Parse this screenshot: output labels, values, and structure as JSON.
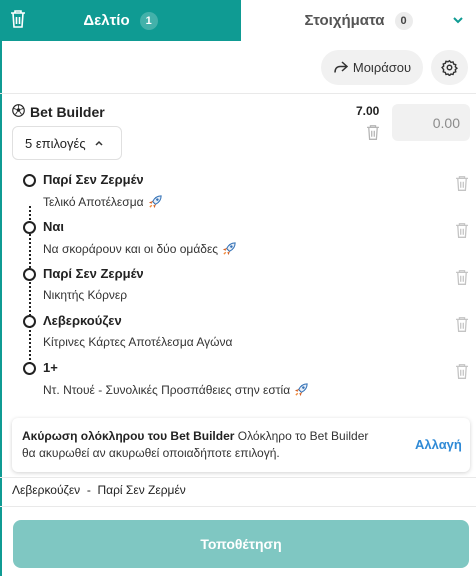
{
  "tabs": {
    "slip_label": "Δελτίο",
    "slip_count": "1",
    "bets_label": "Στοιχήματα",
    "bets_count": "0"
  },
  "toolbar": {
    "share_label": "Μοιράσου"
  },
  "bet_builder": {
    "title": "Bet Builder",
    "odds": "7.00",
    "stake_placeholder": "0.00",
    "selections_label": "5 επιλογές"
  },
  "legs": [
    {
      "selection": "Παρί Σεν Ζερμέν",
      "market": "Τελικό Αποτέλεσμα",
      "boost": true
    },
    {
      "selection": "Ναι",
      "market": "Να σκοράρουν και οι δύο ομάδες",
      "boost": true
    },
    {
      "selection": "Παρί Σεν Ζερμέν",
      "market": "Νικητής Κόρνερ",
      "boost": false
    },
    {
      "selection": "Λεβερκούζεν",
      "market": "Κίτρινες Κάρτες Αποτέλεσμα Αγώνα",
      "boost": false
    },
    {
      "selection": "1+",
      "market": "Ντ. Ντουέ - Συνολικές Προσπάθειες στην εστία",
      "boost": true
    }
  ],
  "cancel_notice": {
    "bold_text": "Ακύρωση ολόκληρου του Bet Builder",
    "text": " Ολόκληρο το Bet Builder θα ακυρωθεί αν ακυρωθεί οποιαδήποτε επιλογή.",
    "link_label": "Αλλαγή"
  },
  "match": {
    "label": "Λεβερκούζεν  -  Παρί Σεν Ζερμέν"
  },
  "place_bet": {
    "label": "Τοποθέτηση"
  },
  "colors": {
    "brand": "#0f9b93",
    "place_button_disabled": "#7fc7c2",
    "link": "#2f8ad6",
    "boost_icon": "#2f8ad6"
  }
}
